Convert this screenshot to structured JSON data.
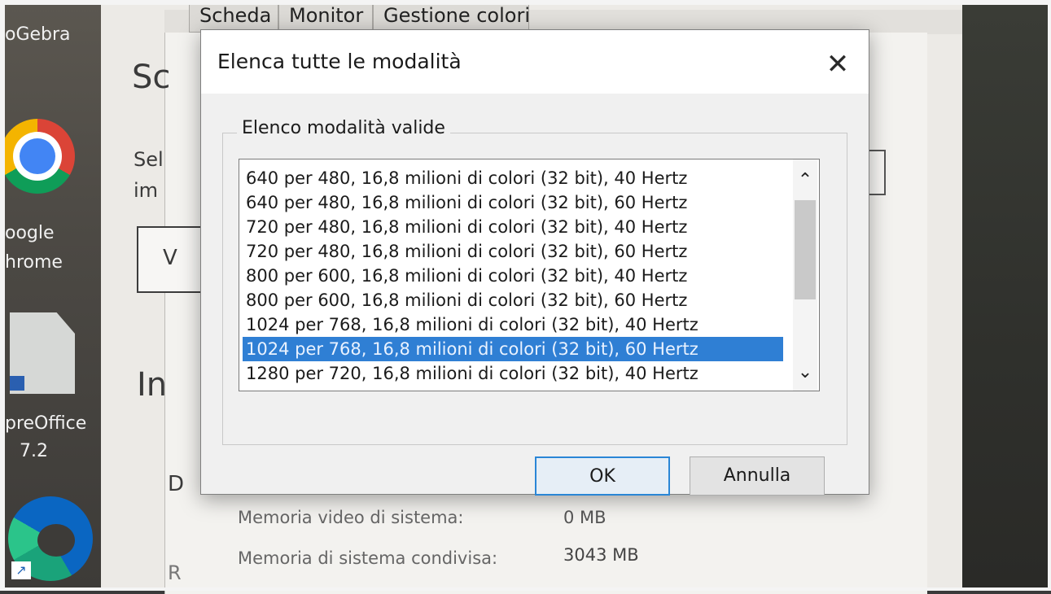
{
  "desktop": {
    "icons": [
      {
        "label_lines": [
          "oGebra"
        ],
        "icon": "geogebra-icon"
      },
      {
        "label_lines": [
          "oogle",
          "hrome"
        ],
        "icon": "chrome-icon"
      },
      {
        "label_lines": [
          "preOffice",
          "7.2"
        ],
        "icon": "libreoffice-icon"
      },
      {
        "label_lines": [],
        "icon": "edge-icon"
      }
    ]
  },
  "background_window": {
    "tabs": [
      "Scheda",
      "Monitor",
      "Gestione colori"
    ],
    "fragments": {
      "heading_left": "Sc",
      "text_sel": "Sel",
      "text_im": "im",
      "box_text": "V",
      "heading_in": "In",
      "frag_d": "D",
      "frag_r": "R"
    },
    "info_rows": [
      {
        "label": "Memoria video di sistema:",
        "value": "0 MB"
      },
      {
        "label": "Memoria di sistema condivisa:",
        "value": "3043 MB"
      }
    ]
  },
  "dialog": {
    "title": "Elenca tutte le modalità",
    "close_symbol": "✕",
    "group_label": "Elenco modalità valide",
    "modes": [
      "640 per 480, 16,8 milioni di colori (32 bit), 40 Hertz",
      "640 per 480, 16,8 milioni di colori (32 bit), 60 Hertz",
      "720 per 480, 16,8 milioni di colori (32 bit), 40 Hertz",
      "720 per 480, 16,8 milioni di colori (32 bit), 60 Hertz",
      "800 per 600, 16,8 milioni di colori (32 bit), 40 Hertz",
      "800 per 600, 16,8 milioni di colori (32 bit), 60 Hertz",
      "1024 per 768, 16,8 milioni di colori (32 bit), 40 Hertz",
      "1024 per 768, 16,8 milioni di colori (32 bit), 60 Hertz",
      "1280 per 720, 16,8 milioni di colori (32 bit), 40 Hertz"
    ],
    "selected_index": 7,
    "scroll_up_symbol": "⌃",
    "scroll_down_symbol": "⌄",
    "ok_label": "OK",
    "cancel_label": "Annulla"
  },
  "colors": {
    "selection": "#2f7fd4",
    "ok_border": "#2a86d6"
  }
}
